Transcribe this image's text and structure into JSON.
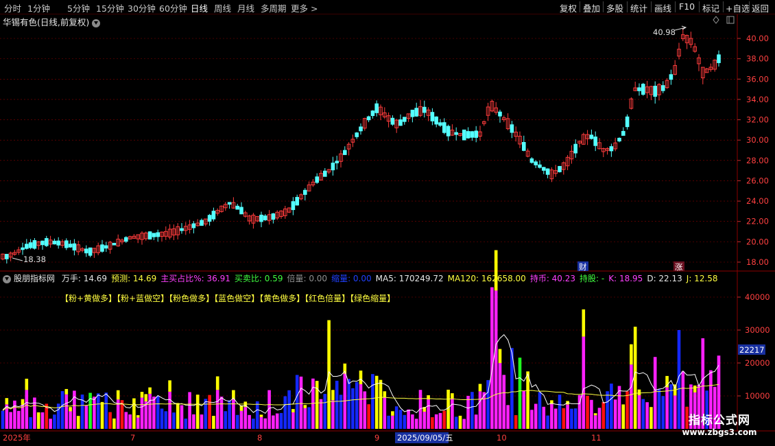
{
  "toolbar": {
    "periods": [
      "分时",
      "1分钟",
      "5分钟",
      "15分钟",
      "30分钟",
      "60分钟",
      "日线",
      "周线",
      "月线",
      "多周期",
      "更多 >"
    ],
    "active_period": "日线",
    "right_buttons": [
      "复权",
      "叠加",
      "多股",
      "统计",
      "画线",
      "F10",
      "标记",
      "+自选",
      "返回"
    ]
  },
  "stock": {
    "title": "华锡有色(日线,前复权)"
  },
  "price_chart": {
    "y_ticks": [
      "40.00",
      "38.00",
      "36.00",
      "34.00",
      "32.00",
      "30.00",
      "28.00",
      "26.00",
      "24.00",
      "22.00",
      "20.00",
      "18.00"
    ],
    "high_label": "40.98",
    "low_label": "18.38",
    "marker_cai": "财",
    "marker_zhang": "涨"
  },
  "indicator": {
    "name": "股朋指标网",
    "items": [
      {
        "text": "万手: 14.69",
        "color": "#e6e6e6"
      },
      {
        "text": "预测: 14.69",
        "color": "#ffff40"
      },
      {
        "text": "主买占比%: 36.91",
        "color": "#ff40ff"
      },
      {
        "text": "买卖比: 0.59",
        "color": "#40ff40"
      },
      {
        "text": "倍量: 0.00",
        "color": "#909090"
      },
      {
        "text": "缩量: 0.00",
        "color": "#2040ff"
      },
      {
        "text": "MA5: 170249.72",
        "color": "#e6e6e6"
      },
      {
        "text": "MA120: 162658.00",
        "color": "#ffff40"
      },
      {
        "text": "持币: 40.23",
        "color": "#ff40ff"
      },
      {
        "text": "持股: -",
        "color": "#40ff40"
      },
      {
        "text": "K: 18.95",
        "color": "#ff40ff"
      },
      {
        "text": "D: 22.13",
        "color": "#e6e6e6"
      },
      {
        "text": "J: 12.58",
        "color": "#ffff40"
      }
    ],
    "legend": "【粉+黄做多】【粉+蓝做空】【粉色做多】【蓝色做空】【黄色做多】【红色倍量】【绿色缩量】",
    "y_ticks": [
      "40000",
      "30000",
      "20000",
      "10000"
    ],
    "current_value": "22217"
  },
  "date_axis": {
    "labels": [
      "2025年",
      "7",
      "8",
      "9",
      "10",
      "11"
    ],
    "cursor_date": "2025/09/05/五"
  },
  "watermark": {
    "line1": "指标公式网",
    "line2": "www.zbgs3.com"
  },
  "colors": {
    "up": "#ff3c3c",
    "down": "#54ffff",
    "pink": "#ff20ff",
    "blue": "#1428ff",
    "yellow": "#ffff00",
    "red": "#ff1010",
    "green": "#20ff20",
    "grid": "#8b0000"
  }
}
